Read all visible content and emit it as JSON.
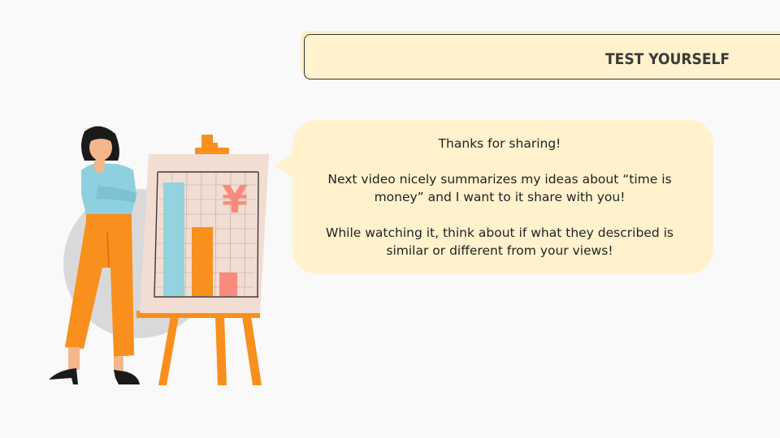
{
  "header": {
    "title": "TEST YOURSELF"
  },
  "bubble": {
    "paragraphs": [
      "Thanks for sharing!",
      "Next video nicely summarizes my ideas about “time is money” and I want to it share with you!",
      "While watching it, think about if what they described is similar or different from your views!"
    ]
  },
  "illustration": {
    "board_symbol": "¥",
    "bars": [
      {
        "color": "#93d3dd",
        "value": 0.9
      },
      {
        "color": "#f98f1c",
        "value": 0.55
      },
      {
        "color": "#f98a7c",
        "value": 0.18
      }
    ],
    "colors": {
      "accent": "#f98f1c",
      "shirt": "#8fd0e0",
      "board": "#f2ddd2",
      "shadow": "#d6d6d6"
    }
  }
}
